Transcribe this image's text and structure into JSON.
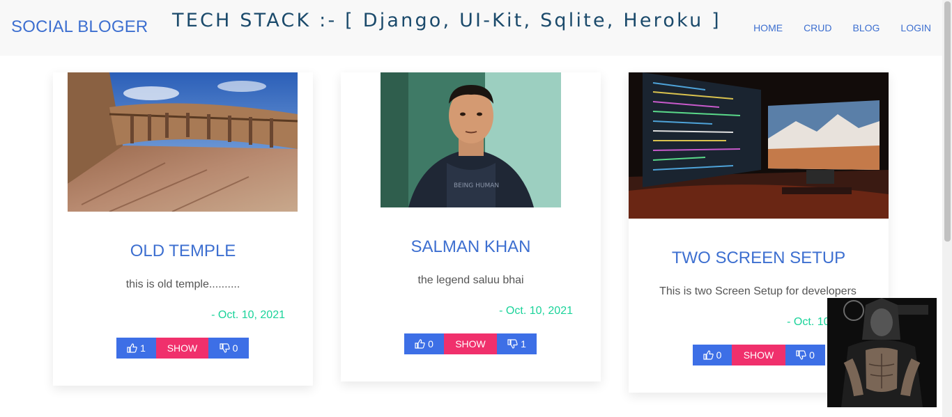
{
  "nav": {
    "brand": "SOCIAL BLOGER",
    "stack_title": "TECH STACK :- [ Django, UI-Kit, Sqlite, Heroku ]",
    "links": [
      "HOME",
      "CRUD",
      "BLOG",
      "LOGIN"
    ]
  },
  "posts": [
    {
      "title": "OLD TEMPLE",
      "text": "this is old temple..........",
      "date": "- Oct. 10, 2021",
      "likes": "1",
      "show": "SHOW",
      "dislikes": "0"
    },
    {
      "title": "SALMAN KHAN",
      "text": "the legend saluu bhai",
      "date": "- Oct. 10, 2021",
      "likes": "0",
      "show": "SHOW",
      "dislikes": "1"
    },
    {
      "title": "TWO SCREEN SETUP",
      "text": "This is two Screen Setup for developers",
      "date": "- Oct. 10, 2021",
      "likes": "0",
      "show": "SHOW",
      "dislikes": "0"
    }
  ],
  "colors": {
    "link": "#3d6fd0",
    "like_button": "#3d6fe6",
    "show_button": "#f0306c",
    "date": "#1bd39a"
  }
}
